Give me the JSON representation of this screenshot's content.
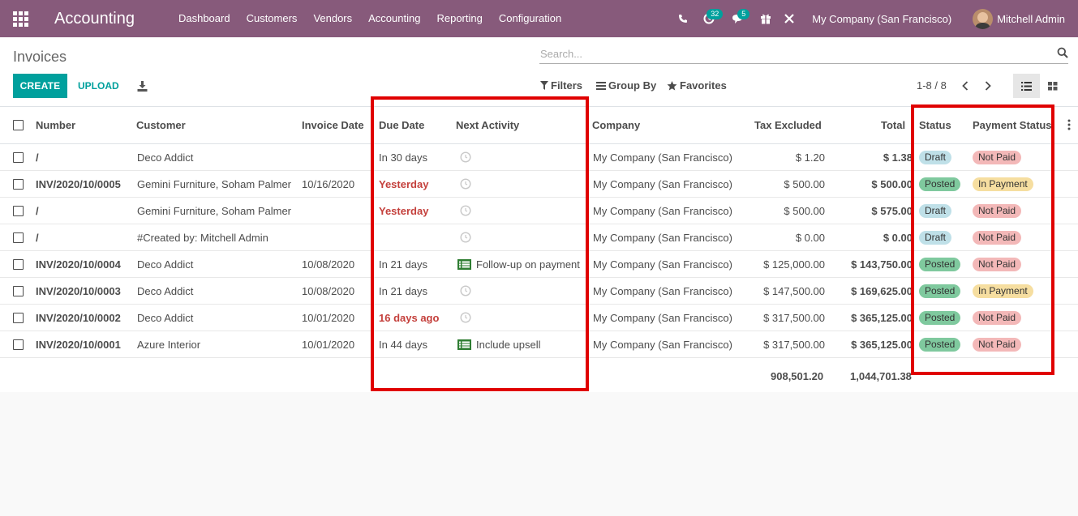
{
  "navbar": {
    "app_title": "Accounting",
    "menu": [
      "Dashboard",
      "Customers",
      "Vendors",
      "Accounting",
      "Reporting",
      "Configuration"
    ],
    "activity_count": "32",
    "message_count": "5",
    "company": "My Company (San Francisco)",
    "user": "Mitchell Admin"
  },
  "control_panel": {
    "title": "Invoices",
    "search_placeholder": "Search...",
    "create_label": "CREATE",
    "upload_label": "UPLOAD",
    "filters_label": "Filters",
    "groupby_label": "Group By",
    "favorites_label": "Favorites",
    "pager": "1-8 / 8"
  },
  "table": {
    "columns": {
      "number": "Number",
      "customer": "Customer",
      "invoice_date": "Invoice Date",
      "due_date": "Due Date",
      "next_activity": "Next Activity",
      "company": "Company",
      "tax_excluded": "Tax Excluded",
      "total": "Total",
      "status": "Status",
      "payment_status": "Payment Status"
    },
    "rows": [
      {
        "number": "/",
        "customer": "Deco Addict",
        "invoice_date": "",
        "due_date": "In 30 days",
        "overdue": false,
        "activity": "",
        "company": "My Company (San Francisco)",
        "tax_excluded": "$ 1.20",
        "total": "$ 1.38",
        "status": "Draft",
        "payment": "Not Paid"
      },
      {
        "number": "INV/2020/10/0005",
        "customer": "Gemini Furniture, Soham Palmer",
        "invoice_date": "10/16/2020",
        "due_date": "Yesterday",
        "overdue": true,
        "activity": "",
        "company": "My Company (San Francisco)",
        "tax_excluded": "$ 500.00",
        "total": "$ 500.00",
        "status": "Posted",
        "payment": "In Payment"
      },
      {
        "number": "/",
        "customer": "Gemini Furniture, Soham Palmer",
        "invoice_date": "",
        "due_date": "Yesterday",
        "overdue": true,
        "activity": "",
        "company": "My Company (San Francisco)",
        "tax_excluded": "$ 500.00",
        "total": "$ 575.00",
        "status": "Draft",
        "payment": "Not Paid"
      },
      {
        "number": "/",
        "customer": "#Created by: Mitchell Admin",
        "invoice_date": "",
        "due_date": "",
        "overdue": false,
        "activity": "",
        "company": "My Company (San Francisco)",
        "tax_excluded": "$ 0.00",
        "total": "$ 0.00",
        "status": "Draft",
        "payment": "Not Paid"
      },
      {
        "number": "INV/2020/10/0004",
        "customer": "Deco Addict",
        "invoice_date": "10/08/2020",
        "due_date": "In 21 days",
        "overdue": false,
        "activity": "Follow-up on payment",
        "company": "My Company (San Francisco)",
        "tax_excluded": "$ 125,000.00",
        "total": "$ 143,750.00",
        "status": "Posted",
        "payment": "Not Paid"
      },
      {
        "number": "INV/2020/10/0003",
        "customer": "Deco Addict",
        "invoice_date": "10/08/2020",
        "due_date": "In 21 days",
        "overdue": false,
        "activity": "",
        "company": "My Company (San Francisco)",
        "tax_excluded": "$ 147,500.00",
        "total": "$ 169,625.00",
        "status": "Posted",
        "payment": "In Payment"
      },
      {
        "number": "INV/2020/10/0002",
        "customer": "Deco Addict",
        "invoice_date": "10/01/2020",
        "due_date": "16 days ago",
        "overdue": true,
        "activity": "",
        "company": "My Company (San Francisco)",
        "tax_excluded": "$ 317,500.00",
        "total": "$ 365,125.00",
        "status": "Posted",
        "payment": "Not Paid"
      },
      {
        "number": "INV/2020/10/0001",
        "customer": "Azure Interior",
        "invoice_date": "10/01/2020",
        "due_date": "In 44 days",
        "overdue": false,
        "activity": "Include upsell",
        "company": "My Company (San Francisco)",
        "tax_excluded": "$ 317,500.00",
        "total": "$ 365,125.00",
        "status": "Posted",
        "payment": "Not Paid"
      }
    ],
    "totals": {
      "tax_excluded": "908,501.20",
      "total": "1,044,701.38"
    }
  },
  "colors": {
    "navbar": "#875a7b",
    "primary": "#00a09d",
    "overdue": "#c4403c",
    "highlight": "#e00000"
  }
}
